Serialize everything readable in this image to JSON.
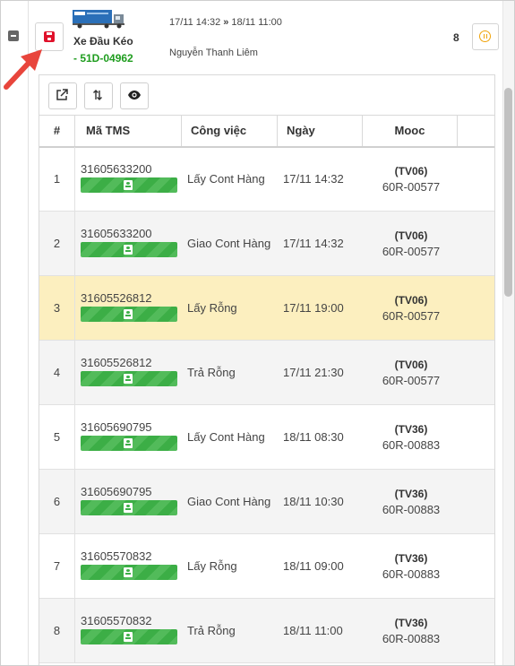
{
  "header": {
    "vehicle_name": "Xe Đầu Kéo",
    "plate": "- 51D-04962",
    "route_from": "17/11 14:32",
    "route_sep": "»",
    "route_to": "18/11 11:00",
    "driver": "Nguyễn Thanh Liêm",
    "count": "8"
  },
  "colors": {
    "accent_red": "#e0112b",
    "plate_green": "#1f9d1f",
    "highlight_row": "#fcefbf",
    "badge_green": "#3cae46",
    "pause_orange": "#f0a30a"
  },
  "icons": {
    "collapse": "minus-square-icon",
    "save": "floppy-disk-icon",
    "truck": "truck-icon",
    "pause": "pause-circle-icon",
    "open_external": "external-link-icon",
    "sort": "sort-arrows-icon",
    "view": "eye-icon",
    "tms_badge": "contact-card-icon",
    "pointer": "red-arrow-icon"
  },
  "table": {
    "columns": [
      "#",
      "Mã TMS",
      "Công việc",
      "Ngày",
      "Mooc"
    ],
    "rows": [
      {
        "num": "1",
        "tms": "31605633200",
        "job": "Lấy Cont Hàng",
        "date": "17/11 14:32",
        "mooc_code": "(TV06)",
        "mooc_plate": "60R-00577"
      },
      {
        "num": "2",
        "tms": "31605633200",
        "job": "Giao Cont Hàng",
        "date": "17/11 14:32",
        "mooc_code": "(TV06)",
        "mooc_plate": "60R-00577"
      },
      {
        "num": "3",
        "tms": "31605526812",
        "job": "Lấy Rỗng",
        "date": "17/11 19:00",
        "mooc_code": "(TV06)",
        "mooc_plate": "60R-00577"
      },
      {
        "num": "4",
        "tms": "31605526812",
        "job": "Trả Rỗng",
        "date": "17/11 21:30",
        "mooc_code": "(TV06)",
        "mooc_plate": "60R-00577"
      },
      {
        "num": "5",
        "tms": "31605690795",
        "job": "Lấy Cont Hàng",
        "date": "18/11 08:30",
        "mooc_code": "(TV36)",
        "mooc_plate": "60R-00883"
      },
      {
        "num": "6",
        "tms": "31605690795",
        "job": "Giao Cont Hàng",
        "date": "18/11 10:30",
        "mooc_code": "(TV36)",
        "mooc_plate": "60R-00883"
      },
      {
        "num": "7",
        "tms": "31605570832",
        "job": "Lấy Rỗng",
        "date": "18/11 09:00",
        "mooc_code": "(TV36)",
        "mooc_plate": "60R-00883"
      },
      {
        "num": "8",
        "tms": "31605570832",
        "job": "Trả Rỗng",
        "date": "18/11 11:00",
        "mooc_code": "(TV36)",
        "mooc_plate": "60R-00883"
      }
    ]
  }
}
